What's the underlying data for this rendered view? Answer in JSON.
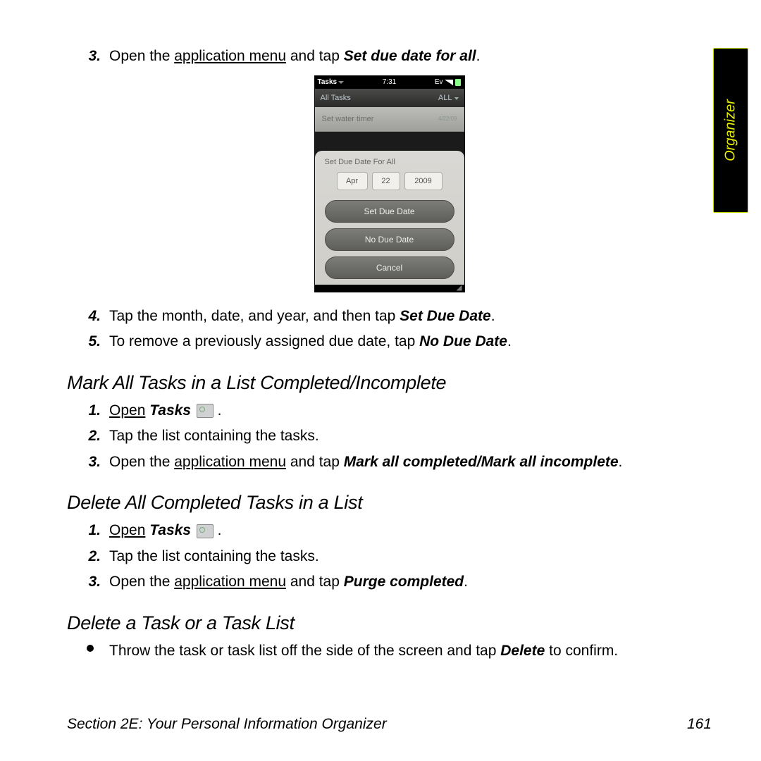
{
  "sideTab": "Organizer",
  "top": {
    "items": {
      "3": {
        "pre": "Open the ",
        "link": "application menu",
        "mid": " and tap ",
        "bold": "Set due date for all",
        "post": "."
      },
      "4": {
        "pre": "Tap the month, date, and year, and then tap ",
        "bold": "Set Due Date",
        "post": "."
      },
      "5": {
        "pre": "To remove a previously assigned due date, tap ",
        "bold": "No Due Date",
        "post": "."
      }
    }
  },
  "h_mark": "Mark All Tasks in a List Completed/Incomplete",
  "mark": {
    "items": {
      "1": {
        "link": "Open",
        "sp": " ",
        "bold": "Tasks",
        "post": " ",
        "dot": " ."
      },
      "2": {
        "text": "Tap the list containing the tasks."
      },
      "3": {
        "pre": "Open the ",
        "link": "application menu",
        "mid": " and tap ",
        "bold": "Mark all completed/Mark all incomplete",
        "post": "."
      }
    }
  },
  "h_delete_all": "Delete All Completed Tasks in a List",
  "delall": {
    "items": {
      "1": {
        "link": "Open",
        "sp": " ",
        "bold": "Tasks",
        "post": " ",
        "dot": " ."
      },
      "2": {
        "text": "Tap the list containing the tasks."
      },
      "3": {
        "pre": "Open the ",
        "link": "application menu",
        "mid": " and tap ",
        "bold": "Purge completed",
        "post": "."
      }
    }
  },
  "h_delete_one": "Delete a Task or a Task List",
  "delone": {
    "pre": "Throw the task or task list off the side of the screen and tap ",
    "bold": "Delete",
    "post": " to confirm."
  },
  "footer": {
    "section": "Section 2E: Your Personal Information Organizer",
    "page": "161"
  },
  "phone": {
    "status": {
      "app": "Tasks",
      "time": "7:31",
      "ev": "Ev"
    },
    "header": {
      "left": "All Tasks",
      "right": "ALL"
    },
    "task": {
      "text": "Set water timer",
      "date": "4/22/09"
    },
    "sheet": {
      "title": "Set Due Date For All",
      "month": "Apr",
      "day": "22",
      "year": "2009",
      "btn1": "Set Due Date",
      "btn2": "No Due Date",
      "btn3": "Cancel"
    }
  }
}
